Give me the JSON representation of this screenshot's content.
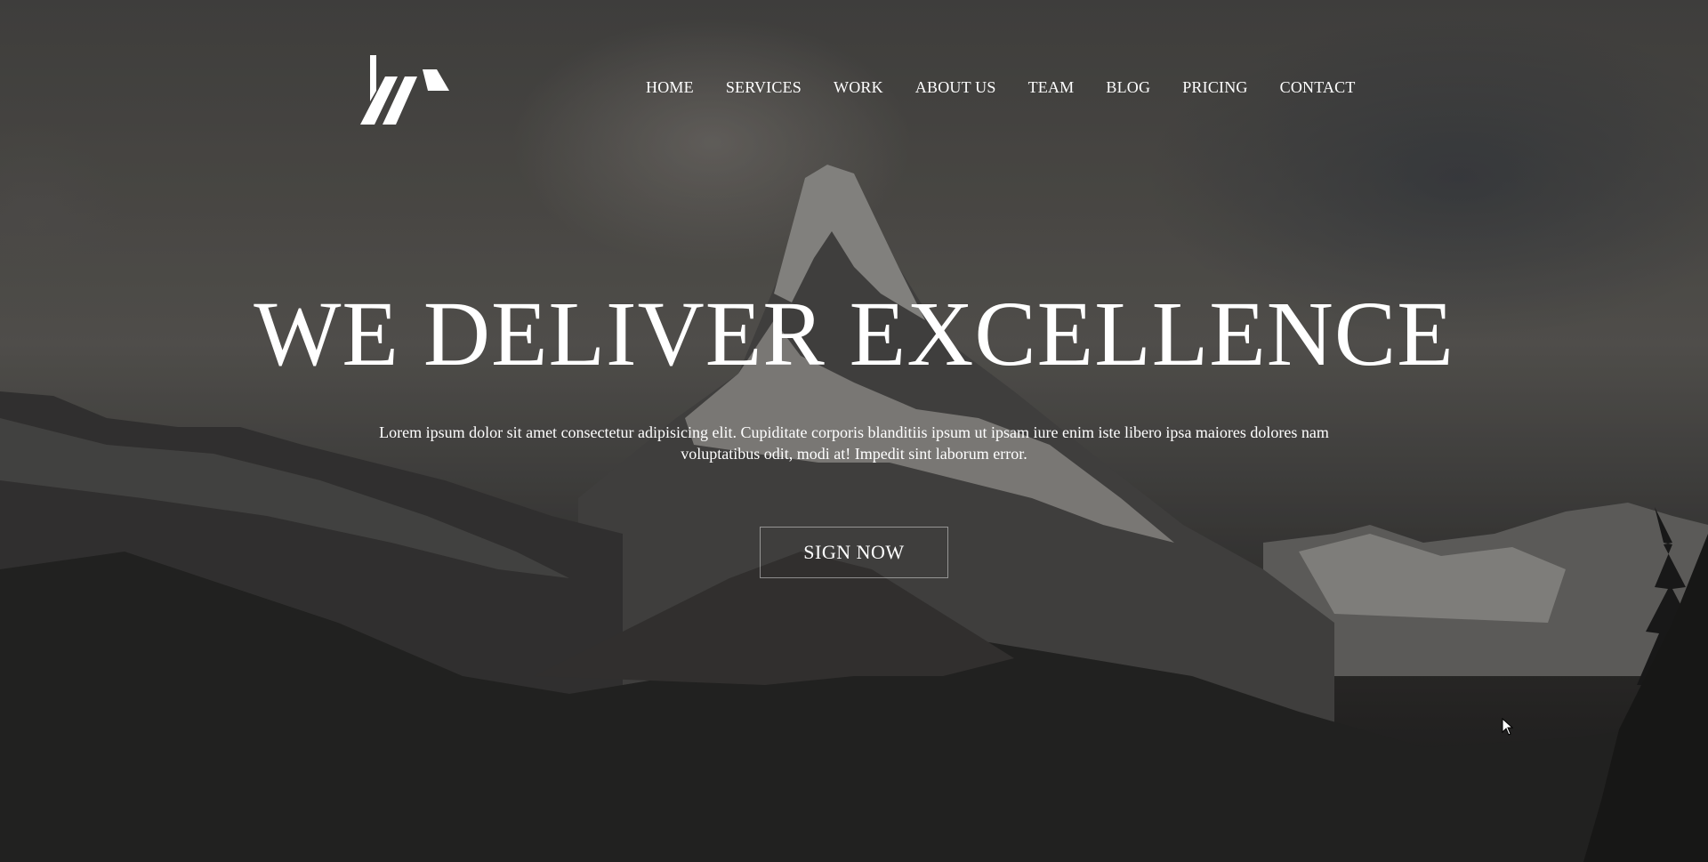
{
  "nav": {
    "items": [
      {
        "label": "HOME"
      },
      {
        "label": "SERVICES"
      },
      {
        "label": "WORK"
      },
      {
        "label": "ABOUT US"
      },
      {
        "label": "TEAM"
      },
      {
        "label": "BLOG"
      },
      {
        "label": "PRICING"
      },
      {
        "label": "CONTACT"
      }
    ]
  },
  "hero": {
    "headline": "WE DELIVER EXCELLENCE",
    "lead": "Lorem ipsum dolor sit amet consectetur adipisicing elit. Cupiditate corporis blanditiis ipsum ut ipsam iure enim iste libero ipsa maiores dolores nam voluptatibus odit, modi at! Impedit sint laborum error.",
    "cta_label": "SIGN NOW"
  },
  "colors": {
    "text": "#ffffff",
    "background_dark": "#1e1d1c",
    "background_sky": "#55534f"
  },
  "icons": {
    "logo": "brand-logo-icon",
    "cursor": "mouse-cursor-icon"
  }
}
